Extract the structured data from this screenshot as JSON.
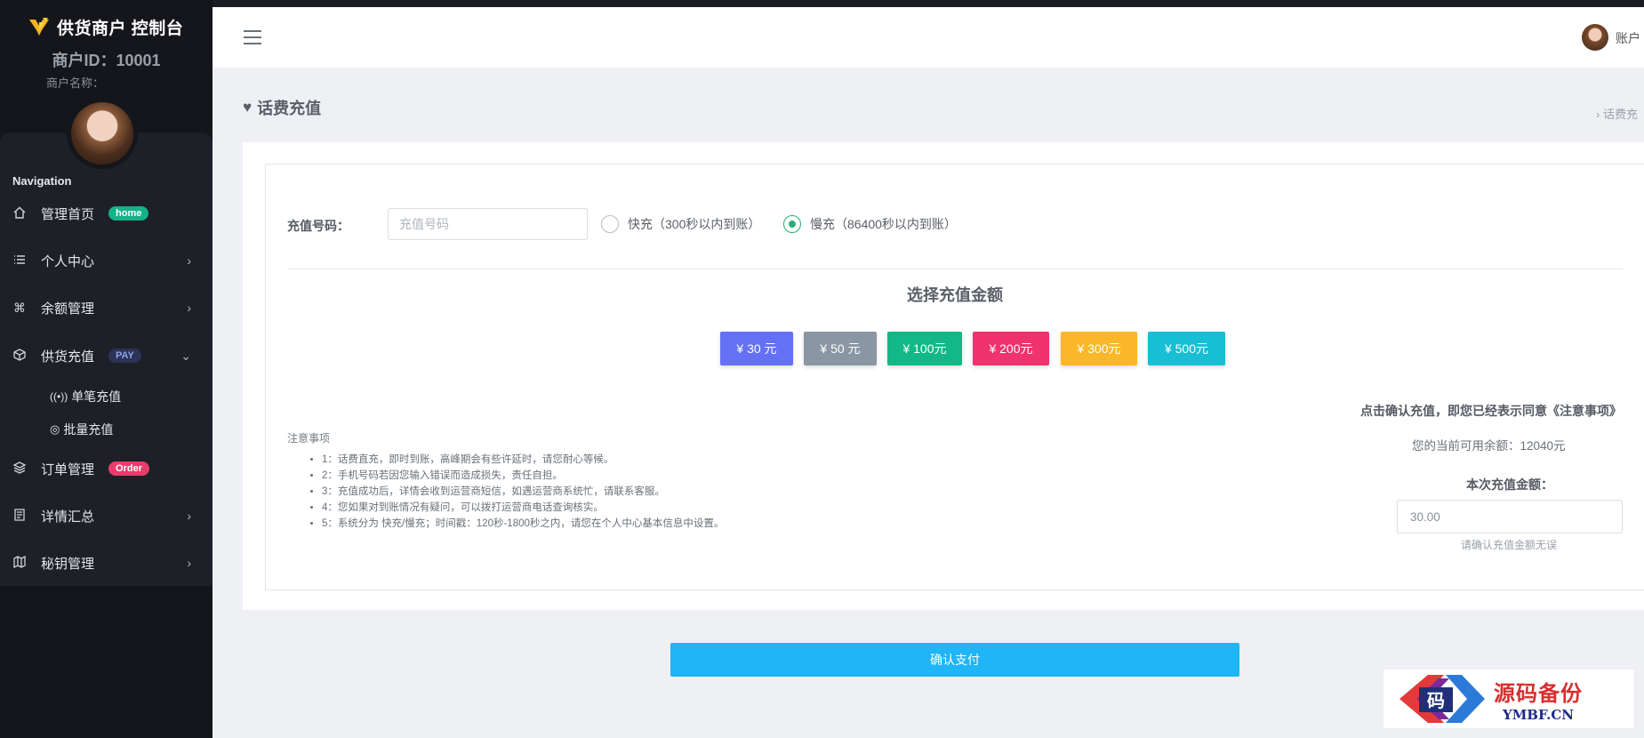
{
  "sidebar": {
    "brand": "供货商户 控制台",
    "merchant_id": "商户ID：10001",
    "merchant_name": "商户名称：",
    "nav_title": "Navigation",
    "items": [
      {
        "label": "管理首页",
        "badge": "home",
        "icon": "home-icon"
      },
      {
        "label": "个人中心",
        "icon": "list-icon"
      },
      {
        "label": "余额管理",
        "icon": "command-icon"
      },
      {
        "label": "供货充值",
        "badge": "PAY",
        "icon": "box-icon"
      },
      {
        "label": "订单管理",
        "badge": "Order",
        "icon": "layers-icon"
      },
      {
        "label": "详情汇总",
        "icon": "document-icon"
      },
      {
        "label": "秘钥管理",
        "icon": "map-icon"
      }
    ],
    "sub_items": [
      {
        "label": "单笔充值",
        "icon": "broadcast-icon"
      },
      {
        "label": "批量充值",
        "icon": "dribbble-icon"
      }
    ]
  },
  "header": {
    "user_name": "账户"
  },
  "page": {
    "title": "话费充值",
    "breadcrumb": "›  话费充"
  },
  "form": {
    "phone_label": "充值号码：",
    "phone_placeholder": "充值号码",
    "radio_fast": "快充（300秒以内到账）",
    "radio_slow": "慢充（86400秒以内到账）",
    "selected_radio": "slow",
    "amount_title": "选择充值金额",
    "amounts": [
      {
        "label": "¥ 30 元",
        "color": "#6471f4"
      },
      {
        "label": "¥ 50 元",
        "color": "#8a96a3"
      },
      {
        "label": "¥ 100元",
        "color": "#12b886"
      },
      {
        "label": "¥ 200元",
        "color": "#f0326e"
      },
      {
        "label": "¥ 300元",
        "color": "#fbb72a"
      },
      {
        "label": "¥ 500元",
        "color": "#18bed3"
      }
    ],
    "notes_title": "注意事项",
    "notes": [
      "1：话费直充，即时到账，高峰期会有些许延时，请您耐心等候。",
      "2：手机号码若因您输入错误而造成损失，责任自担。",
      "3：充值成功后，详情会收到运营商短信，如遇运营商系统忙，请联系客服。",
      "4：您如果对到账情况有疑问，可以拨打运营商电话查询核实。",
      "5：系统分为 快充/慢充；时间戳：120秒-1800秒之内，请您在个人中心基本信息中设置。"
    ],
    "agree_text": "点击确认充值，即您已经表示同意《注意事项》",
    "balance_text": "您的当前可用余额：12040元",
    "amount_label": "本次充值金额：",
    "amount_value": "30.00",
    "amount_hint": "请确认充值金额无误",
    "pay_button": "确认支付"
  },
  "watermark": {
    "logo_char": "码",
    "cn": "源码备份",
    "en": "YMBF.CN"
  }
}
